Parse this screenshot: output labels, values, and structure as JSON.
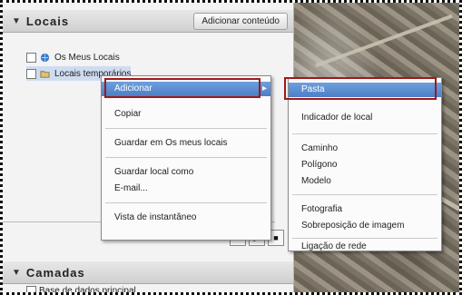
{
  "panel": {
    "locais_title": "Locais",
    "add_content": "Adicionar conteúdo",
    "tree": [
      {
        "label": "Os Meus Locais"
      },
      {
        "label": "Locais temporários"
      }
    ],
    "camadas_title": "Camadas",
    "camadas_item": "Base de dados principal"
  },
  "menu1": {
    "items": [
      "Adicionar",
      "Copiar",
      "Guardar em Os meus locais",
      "Guardar local como",
      "E-mail...",
      "Vista de instantâneo"
    ],
    "submenu_arrow": "▸"
  },
  "menu2": {
    "items": [
      "Pasta",
      "Indicador de local",
      "Caminho",
      "Polígono",
      "Modelo",
      "Fotografia",
      "Sobreposição de imagem",
      "Ligação de rede"
    ]
  },
  "transport": {
    "play": "▶",
    "stop": "■"
  }
}
